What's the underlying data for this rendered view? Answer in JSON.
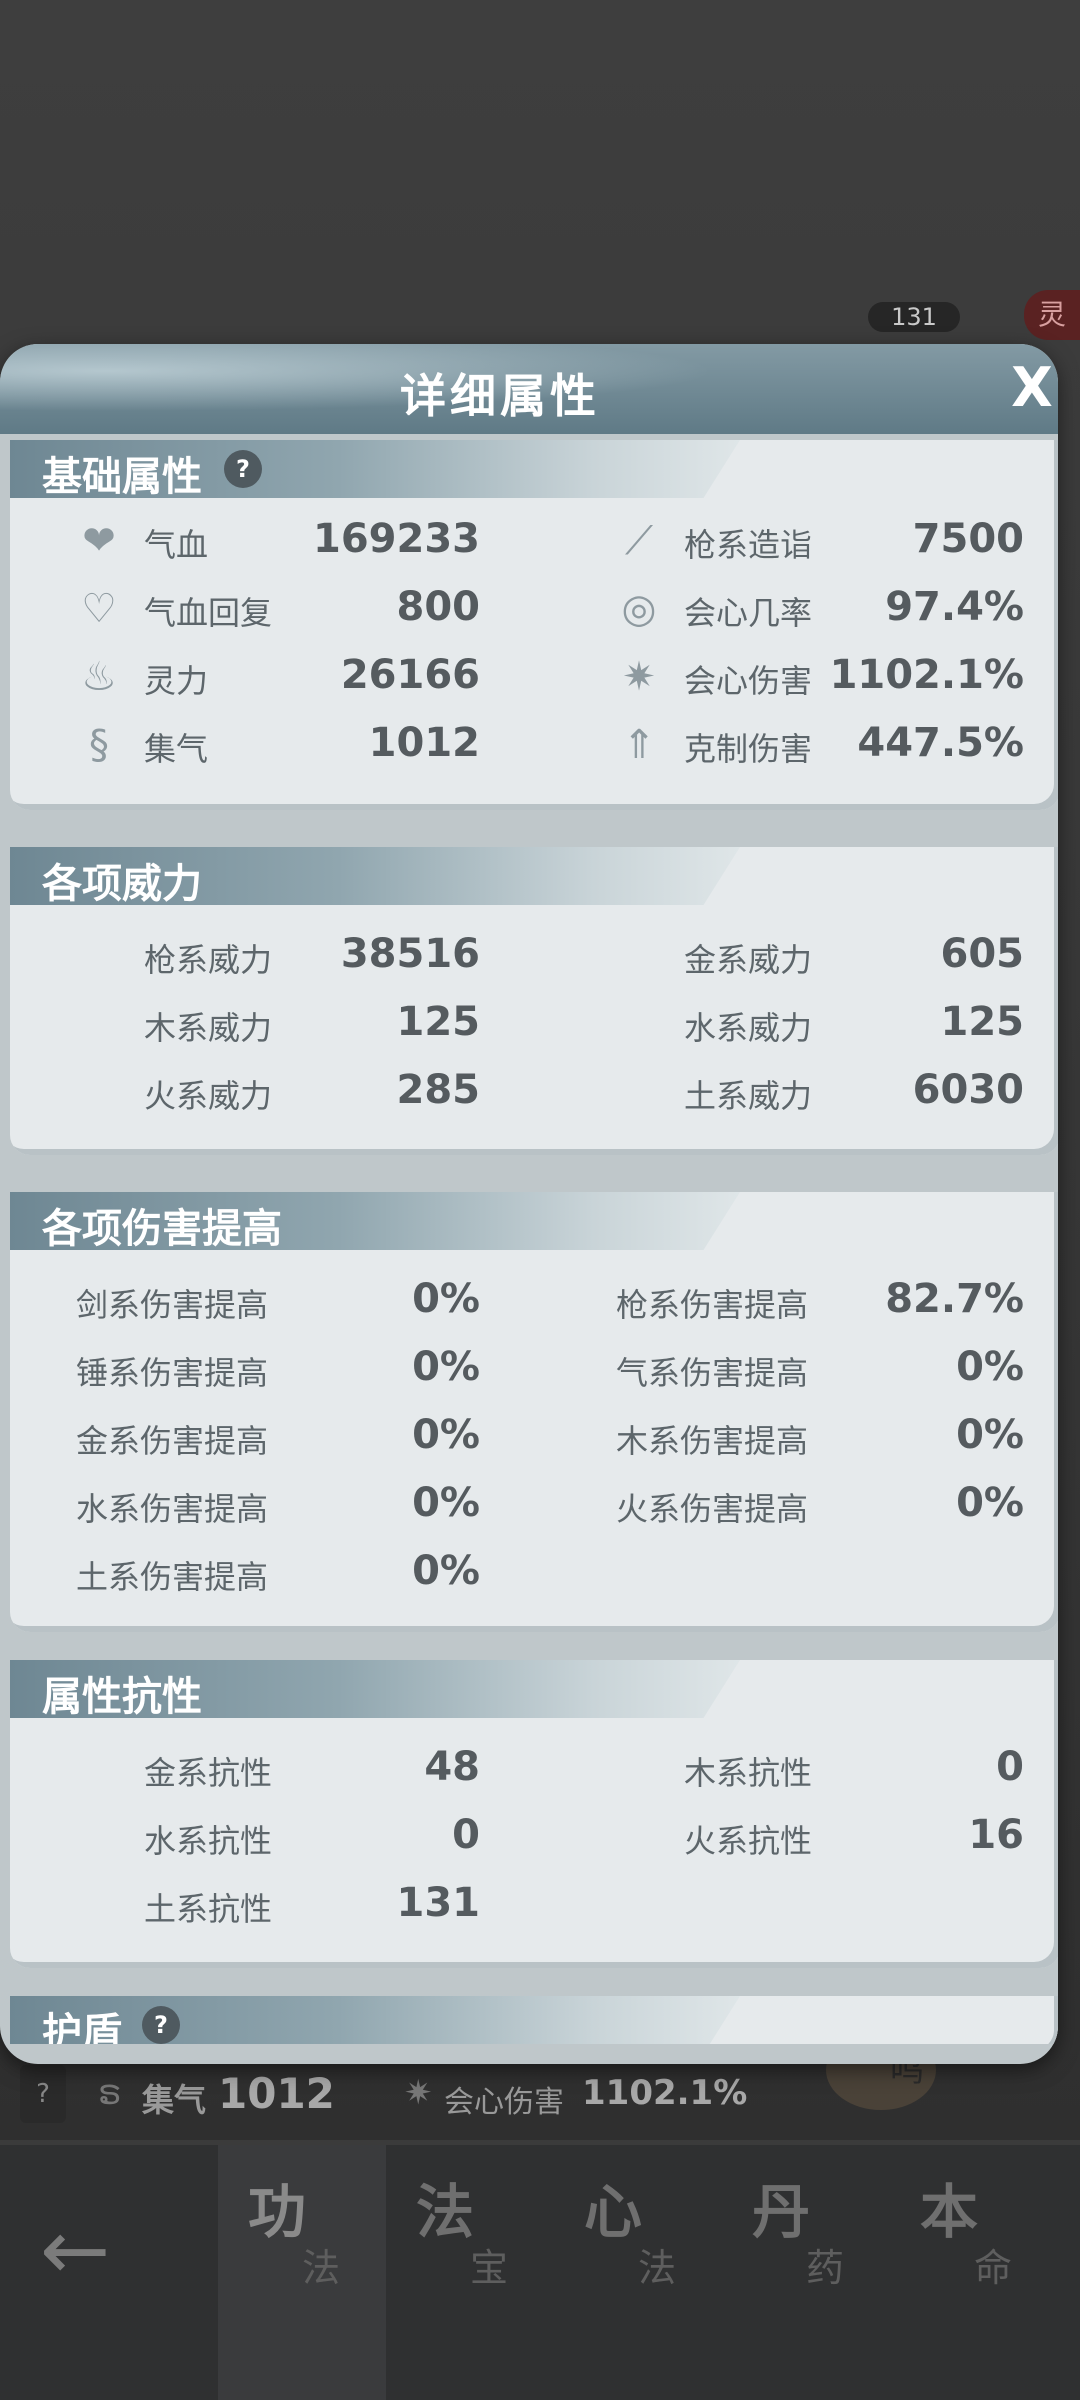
{
  "background": {
    "badge": "131",
    "tag": "灵",
    "summary": {
      "help": "?",
      "stat1_label": "集气",
      "stat1_value": "1012",
      "stat2_label": "会心伤害",
      "stat2_value": "1102.1%",
      "orb_text": "鸣"
    }
  },
  "modal": {
    "title": "详细属性",
    "close": "X",
    "sections": {
      "basic": {
        "title": "基础属性",
        "help": "?",
        "left": [
          {
            "icon": "heart-icon",
            "label": "气血",
            "value": "169233"
          },
          {
            "icon": "heart-regen-icon",
            "label": "气血回复",
            "value": "800"
          },
          {
            "icon": "spirit-flame-icon",
            "label": "灵力",
            "value": "26166"
          },
          {
            "icon": "swirl-icon",
            "label": "集气",
            "value": "1012"
          }
        ],
        "right": [
          {
            "icon": "spear-icon",
            "label": "枪系造诣",
            "value": "7500"
          },
          {
            "icon": "crit-rate-icon",
            "label": "会心几率",
            "value": "97.4%"
          },
          {
            "icon": "crit-damage-icon",
            "label": "会心伤害",
            "value": "1102.1%"
          },
          {
            "icon": "counter-damage-icon",
            "label": "克制伤害",
            "value": "447.5%"
          }
        ]
      },
      "power": {
        "title": "各项威力",
        "left": [
          {
            "label": "枪系威力",
            "value": "38516"
          },
          {
            "label": "木系威力",
            "value": "125"
          },
          {
            "label": "火系威力",
            "value": "285"
          }
        ],
        "right": [
          {
            "label": "金系威力",
            "value": "605"
          },
          {
            "label": "水系威力",
            "value": "125"
          },
          {
            "label": "土系威力",
            "value": "6030"
          }
        ]
      },
      "damage": {
        "title": "各项伤害提高",
        "left": [
          {
            "label": "剑系伤害提高",
            "value": "0%"
          },
          {
            "label": "锤系伤害提高",
            "value": "0%"
          },
          {
            "label": "金系伤害提高",
            "value": "0%"
          },
          {
            "label": "水系伤害提高",
            "value": "0%"
          },
          {
            "label": "土系伤害提高",
            "value": "0%"
          }
        ],
        "right": [
          {
            "label": "枪系伤害提高",
            "value": "82.7%"
          },
          {
            "label": "气系伤害提高",
            "value": "0%"
          },
          {
            "label": "木系伤害提高",
            "value": "0%"
          },
          {
            "label": "火系伤害提高",
            "value": "0%"
          }
        ]
      },
      "resist": {
        "title": "属性抗性",
        "left": [
          {
            "label": "金系抗性",
            "value": "48"
          },
          {
            "label": "水系抗性",
            "value": "0"
          },
          {
            "label": "土系抗性",
            "value": "131"
          }
        ],
        "right": [
          {
            "label": "木系抗性",
            "value": "0"
          },
          {
            "label": "火系抗性",
            "value": "16"
          }
        ]
      },
      "shield": {
        "title": "护盾",
        "help": "?"
      }
    }
  },
  "bottom_nav": {
    "back": "←",
    "tabs": [
      {
        "top": "功",
        "bottom": "法"
      },
      {
        "top": "法",
        "bottom": "宝"
      },
      {
        "top": "心",
        "bottom": "法"
      },
      {
        "top": "丹",
        "bottom": "药"
      },
      {
        "top": "本",
        "bottom": "命"
      }
    ]
  }
}
